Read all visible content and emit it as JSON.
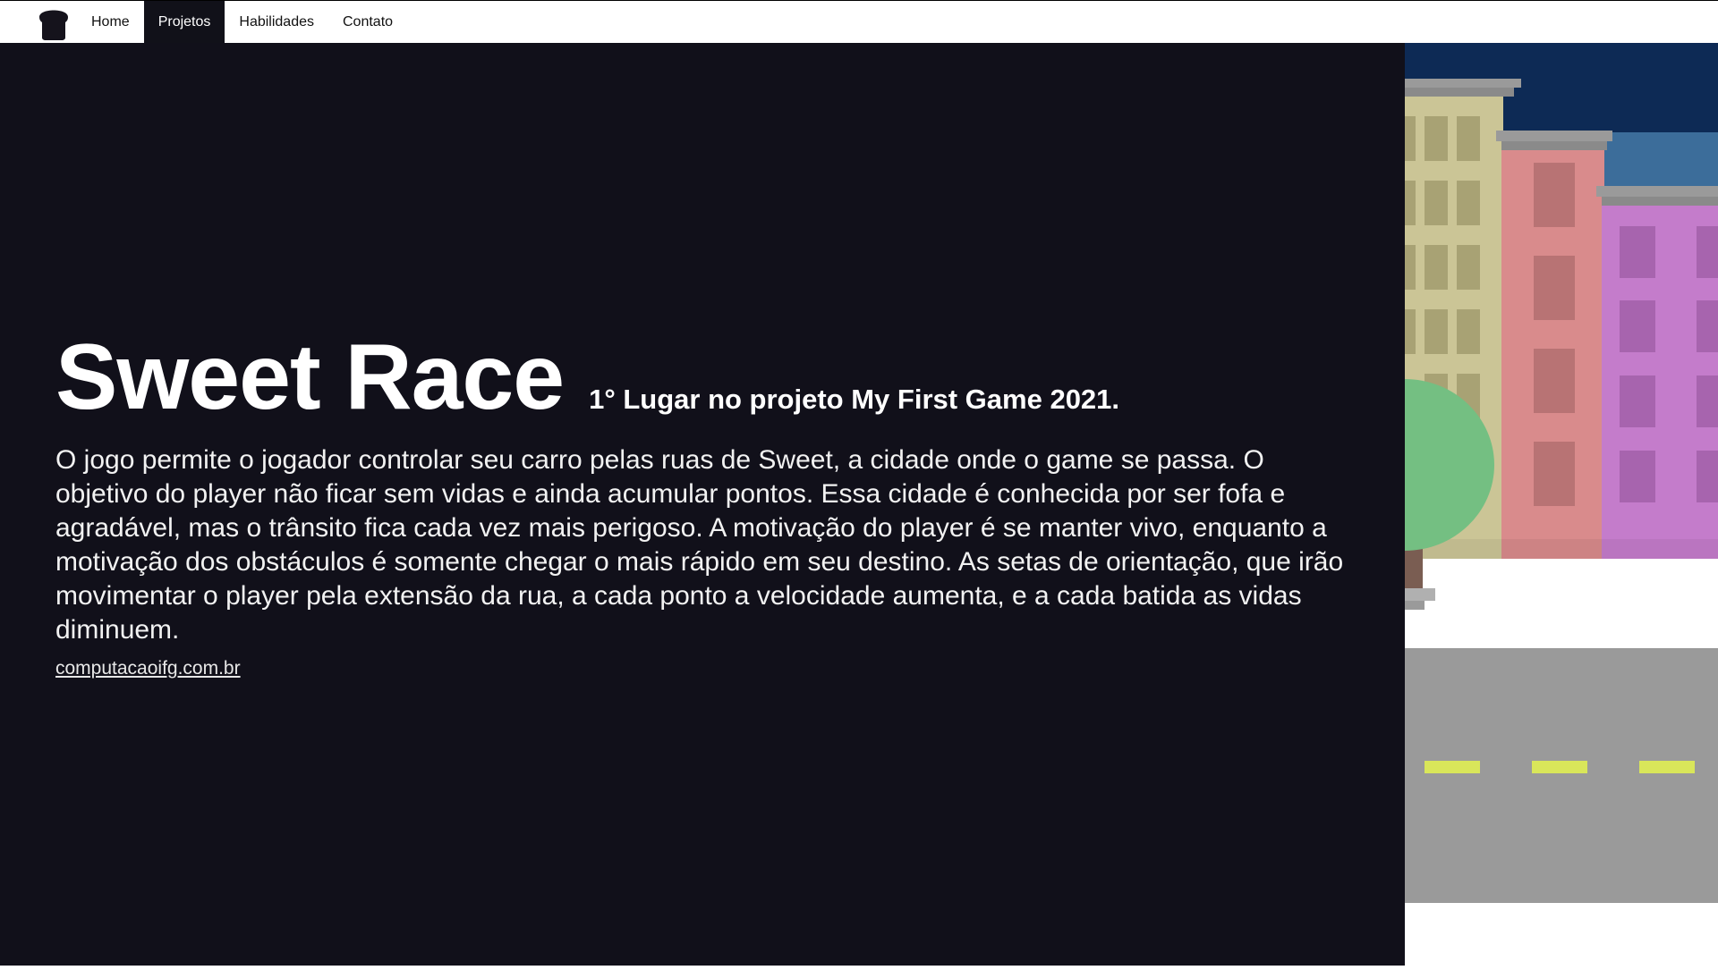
{
  "nav": {
    "logo_icon": "bread-slice-icon",
    "items": [
      {
        "label": "Home",
        "active": false
      },
      {
        "label": "Projetos",
        "active": true
      },
      {
        "label": "Habilidades",
        "active": false
      },
      {
        "label": "Contato",
        "active": false
      }
    ]
  },
  "project": {
    "title": "Sweet Race",
    "award": "1° Lugar no projeto My First Game 2021.",
    "description": "O jogo permite o jogador controlar seu carro pelas ruas de Sweet, a cidade onde o game se passa. O objetivo do player não ficar sem vidas e ainda acumular pontos. Essa cidade é conhecida por ser fofa e agradável, mas o trânsito fica cada vez mais perigoso. A motivação do player é se manter vivo, enquanto a motivação dos obstáculos é somente chegar o mais rápido em seu destino. As setas de orientação, que irão movimentar o player pela extensão da rua, a cada ponto a velocidade aumenta, e a cada batida as vidas diminuem.",
    "link": "computacaoifg.com.br"
  },
  "colors": {
    "background": "#11101a",
    "sky": "#0d2a55",
    "road": "#9a9a9a",
    "lane_marking": "#d9e65a",
    "building_yellow": "#cbc596",
    "building_pink": "#d98b8c",
    "building_purple": "#c47ccb",
    "building_blue": "#3c6d9a",
    "tree": "#74bf82"
  }
}
